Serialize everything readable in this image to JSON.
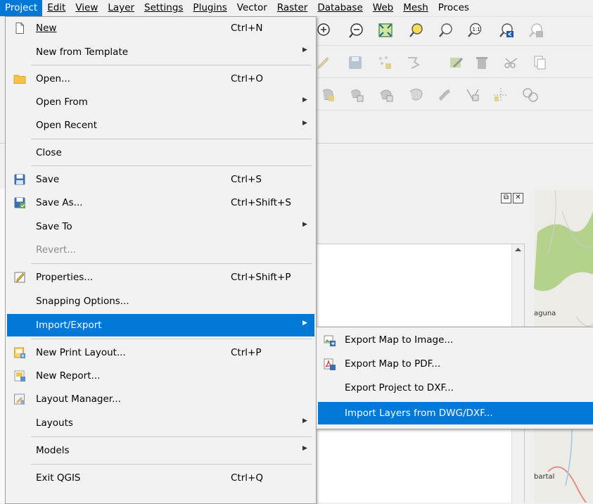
{
  "menubar": {
    "items": [
      {
        "label": "Project"
      },
      {
        "label": "Edit"
      },
      {
        "label": "View"
      },
      {
        "label": "Layer"
      },
      {
        "label": "Settings"
      },
      {
        "label": "Plugins"
      },
      {
        "label": "Vector"
      },
      {
        "label": "Raster"
      },
      {
        "label": "Database"
      },
      {
        "label": "Web"
      },
      {
        "label": "Mesh"
      },
      {
        "label": "Proces"
      }
    ]
  },
  "project_menu": {
    "items": [
      {
        "label": "New",
        "shortcut": "Ctrl+N",
        "icon": "new-document-icon"
      },
      {
        "label": "New from Template",
        "submenu": true
      },
      {
        "label": "Open...",
        "shortcut": "Ctrl+O",
        "icon": "folder-icon"
      },
      {
        "label": "Open From",
        "submenu": true
      },
      {
        "label": "Open Recent",
        "submenu": true
      },
      {
        "label": "Close"
      },
      {
        "label": "Save",
        "shortcut": "Ctrl+S",
        "icon": "save-icon"
      },
      {
        "label": "Save As...",
        "shortcut": "Ctrl+Shift+S",
        "icon": "save-as-icon"
      },
      {
        "label": "Save To",
        "submenu": true
      },
      {
        "label": "Revert...",
        "disabled": true
      },
      {
        "label": "Properties...",
        "shortcut": "Ctrl+Shift+P",
        "icon": "properties-icon"
      },
      {
        "label": "Snapping Options..."
      },
      {
        "label": "Import/Export",
        "submenu": true,
        "highlighted": true
      },
      {
        "label": "New Print Layout...",
        "shortcut": "Ctrl+P",
        "icon": "new-print-layout-icon"
      },
      {
        "label": "New Report...",
        "icon": "new-report-icon"
      },
      {
        "label": "Layout Manager...",
        "icon": "layout-manager-icon"
      },
      {
        "label": "Layouts",
        "submenu": true
      },
      {
        "label": "Models",
        "submenu": true
      },
      {
        "label": "Exit QGIS",
        "shortcut": "Ctrl+Q"
      }
    ]
  },
  "import_export_submenu": {
    "items": [
      {
        "label": "Export Map to Image...",
        "icon": "export-image-icon"
      },
      {
        "label": "Export Map to PDF...",
        "icon": "export-pdf-icon"
      },
      {
        "label": "Export Project to DXF..."
      },
      {
        "label": "Import Layers from DWG/DXF...",
        "highlighted": true
      }
    ]
  },
  "map": {
    "labels": [
      "aguna",
      "bartal"
    ]
  },
  "colors": {
    "highlight": "#0078d7",
    "menu_bg": "#f2f2f2"
  }
}
